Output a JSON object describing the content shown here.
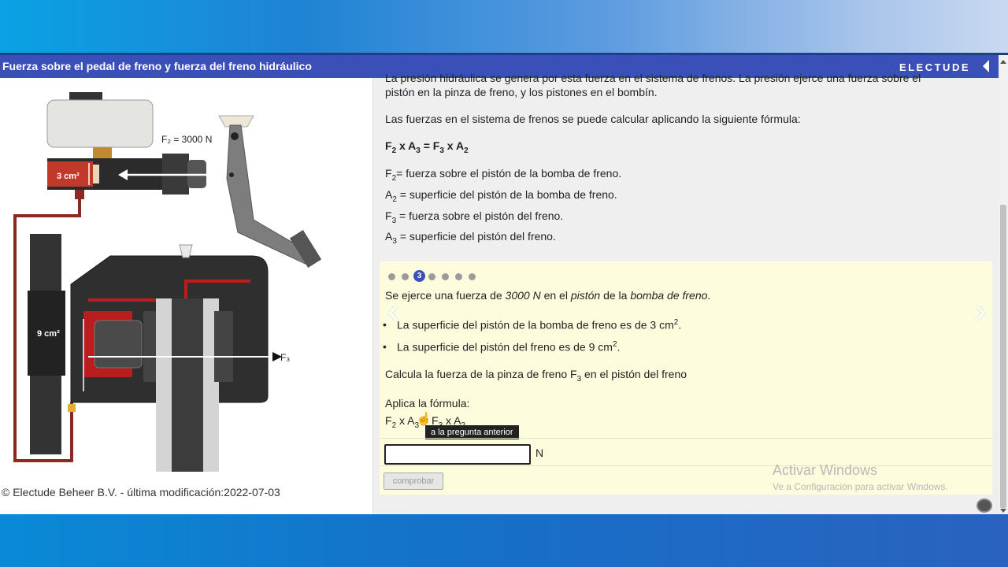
{
  "header": {
    "title": "Fuerza sobre el pedal de freno y fuerza del freno hidráulico",
    "brand": "ELECTUDE"
  },
  "diagram": {
    "force_label": "F₂ = 3000 N",
    "master_area": "3 cm²",
    "caliper_area": "9 cm²",
    "output_label": "F₃"
  },
  "footer": {
    "copyright": "© Electude Beheer B.V. - última modificación:2022-07-03"
  },
  "content": {
    "cutoff": "La presión hidráulica se genera por esta fuerza en el sistema de frenos. La presión ejerce una fuerza sobre el",
    "intro_line2": "pistón en la pinza de freno, y los pistones en el bombín.",
    "formula_intro": "Las fuerzas en el sistema de frenos se puede calcular aplicando la siguiente fórmula:",
    "formula": {
      "a": "F",
      "a_sub": "2",
      "b": " x A",
      "b_sub": "3",
      "c": " = F",
      "c_sub": "3",
      "d": " x A",
      "d_sub": "2"
    },
    "definitions": [
      {
        "sym": "F",
        "sub": "2",
        "text": "= fuerza sobre el pistón de la bomba de freno."
      },
      {
        "sym": "A",
        "sub": "2",
        "text": " = superficie del pistón de la bomba de freno."
      },
      {
        "sym": "F",
        "sub": "3",
        "text": " = fuerza sobre el pistón del freno."
      },
      {
        "sym": "A",
        "sub": "3",
        "text": " = superficie del pistón del freno."
      }
    ]
  },
  "question": {
    "active_step": "3",
    "line1_a": "Se ejerce una fuerza de ",
    "line1_b": "3000 N",
    "line1_c": " en el ",
    "line1_d": "pistón",
    "line1_e": " de la ",
    "line1_f": "bomba de freno",
    "line1_g": ".",
    "bullet1": "La superficie del pistón de la bomba de freno es de 3 cm",
    "bullet2": "La superficie del pistón del freno es de 9 cm",
    "sup": "2",
    "task_a": "Calcula la fuerza de la pinza de freno F",
    "task_sub": "3",
    "task_b": " en el pistón del freno",
    "apply": "Aplica la fórmula:",
    "f_a": "F",
    "f_a_sub": "2",
    "f_b": " x A",
    "f_b_sub": "3",
    "f_c": " = F",
    "f_c_sub": "3",
    "f_d": " x A",
    "f_d_sub": "2",
    "tooltip": "a la pregunta anterior",
    "answer_value": "",
    "unit": "N",
    "check_button": "comprobar"
  },
  "watermark": {
    "title": "Activar Windows",
    "subtitle": "Ve a Configuración para activar Windows."
  }
}
